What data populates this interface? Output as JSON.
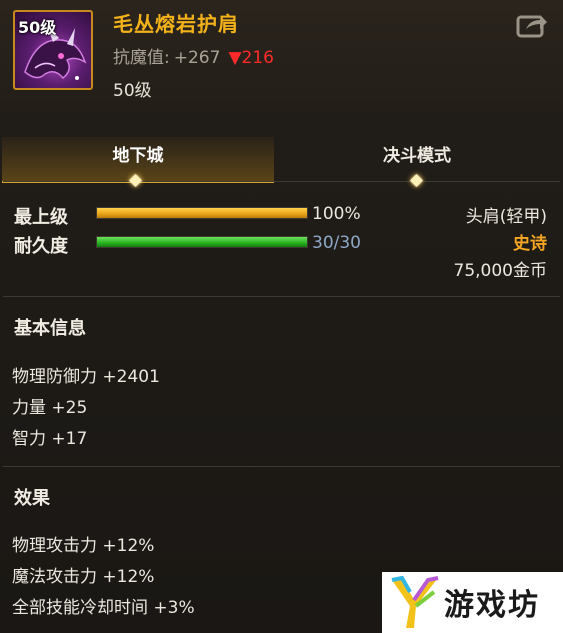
{
  "item": {
    "level_badge": "50级",
    "name": "毛丛熔岩护肩",
    "resist_label": "抗魔值:",
    "resist_value": "+267",
    "resist_down": "▼216",
    "required_level": "50级"
  },
  "tabs": [
    {
      "label": "地下城",
      "active": true
    },
    {
      "label": "决斗模式",
      "active": false
    }
  ],
  "stats": {
    "grade": {
      "label": "最上级",
      "value": "100%",
      "fill": 1.0
    },
    "durability": {
      "label": "耐久度",
      "value": "30/30",
      "fill": 1.0
    }
  },
  "info": {
    "slot": "头肩(轻甲)",
    "rarity": "史诗",
    "price": "75,000金币"
  },
  "basic": {
    "title": "基本信息",
    "lines": [
      "物理防御力 +2401",
      "力量 +25",
      "智力 +17"
    ]
  },
  "effects": {
    "title": "效果",
    "lines": [
      "物理攻击力 +12%",
      "魔法攻击力 +12%",
      "全部技能冷却时间 +3%"
    ]
  },
  "watermark": {
    "text": "游戏坊"
  },
  "colors": {
    "gold": "#f3b21a",
    "orange": "#f5a623",
    "epic": "#f5a623",
    "down_red": "#ff2a2a",
    "durability_blue": "#8ea8c8",
    "grade_bar": "#e8a317",
    "durability_bar": "#27b21e"
  }
}
